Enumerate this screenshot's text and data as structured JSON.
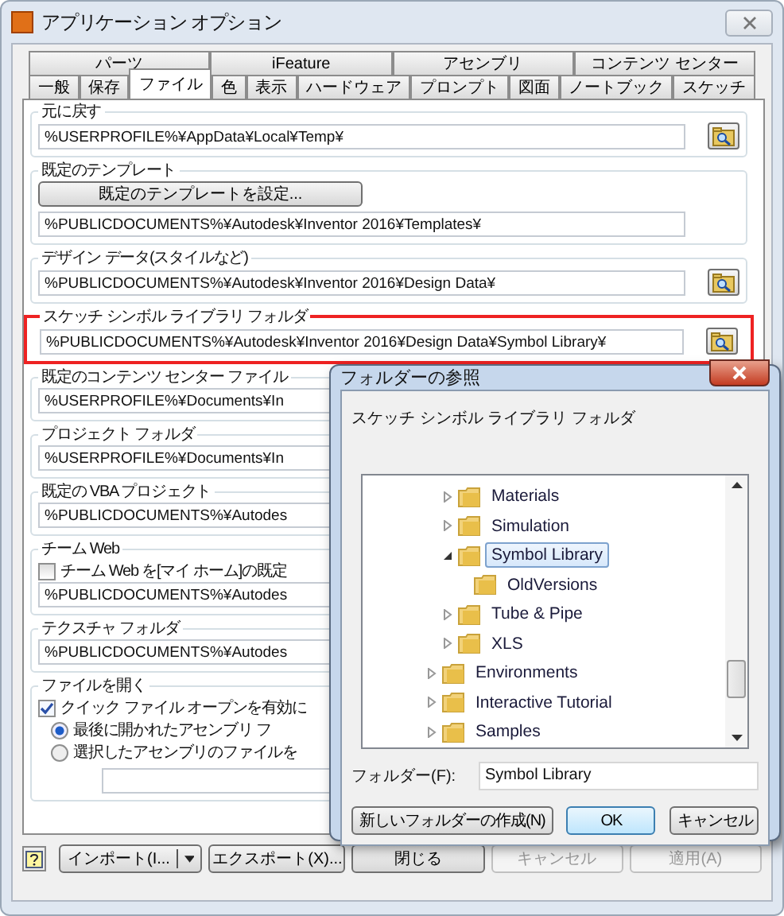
{
  "window": {
    "title": "アプリケーション オプション"
  },
  "tabs_top": [
    {
      "label": "パーツ",
      "selected": false
    },
    {
      "label": "iFeature",
      "selected": false
    },
    {
      "label": "アセンブリ",
      "selected": false
    },
    {
      "label": "コンテンツ センター",
      "selected": false
    }
  ],
  "tabs_bottom": [
    {
      "label": "一般",
      "selected": false
    },
    {
      "label": "保存",
      "selected": false
    },
    {
      "label": "ファイル",
      "selected": true
    },
    {
      "label": "色",
      "selected": false
    },
    {
      "label": "表示",
      "selected": false
    },
    {
      "label": "ハードウェア",
      "selected": false
    },
    {
      "label": "プロンプト",
      "selected": false
    },
    {
      "label": "図面",
      "selected": false
    },
    {
      "label": "ノートブック",
      "selected": false
    },
    {
      "label": "スケッチ",
      "selected": false
    }
  ],
  "sections": [
    {
      "kind": "path",
      "label": "元に戻す",
      "value": "%USERPROFILE%¥AppData¥Local¥Temp¥",
      "browse": true,
      "highlighted": false
    },
    {
      "kind": "button_path",
      "label": "既定のテンプレート",
      "button": "既定のテンプレートを設定...",
      "value": "%PUBLICDOCUMENTS%¥Autodesk¥Inventor 2016¥Templates¥",
      "highlighted": false
    },
    {
      "kind": "path",
      "label": "デザイン データ(スタイルなど)",
      "value": "%PUBLICDOCUMENTS%¥Autodesk¥Inventor 2016¥Design Data¥",
      "browse": true,
      "highlighted": false
    },
    {
      "kind": "path",
      "label": "スケッチ シンボル ライブラリ フォルダ",
      "value": "%PUBLICDOCUMENTS%¥Autodesk¥Inventor 2016¥Design Data¥Symbol Library¥",
      "browse": true,
      "highlighted": true
    },
    {
      "kind": "path",
      "label": "既定のコンテンツ センター ファイル",
      "value": "%USERPROFILE%¥Documents¥In",
      "highlighted": false
    },
    {
      "kind": "path",
      "label": "プロジェクト フォルダ",
      "value": "%USERPROFILE%¥Documents¥In",
      "highlighted": false
    },
    {
      "kind": "path",
      "label": "既定の VBA プロジェクト",
      "value": "%PUBLICDOCUMENTS%¥Autodes",
      "highlighted": false
    },
    {
      "kind": "checkbox_path",
      "label": "チーム Web",
      "checkbox": {
        "label": "チーム Web を[マイ ホーム]の既定",
        "checked": false
      },
      "value": "%PUBLICDOCUMENTS%¥Autodes",
      "highlighted": false
    },
    {
      "kind": "path",
      "label": "テクスチャ フォルダ",
      "value": "%PUBLICDOCUMENTS%¥Autodes",
      "highlighted": false
    },
    {
      "kind": "file_open",
      "label": "ファイルを開く",
      "checkbox": {
        "label": "クイック ファイル オープンを有効に",
        "checked": true
      },
      "radios": [
        {
          "label": "最後に開かれたアセンブリ フ",
          "selected": true
        },
        {
          "label": "選択したアセンブリのファイルを",
          "selected": false
        }
      ],
      "highlighted": false
    }
  ],
  "footer_buttons": [
    {
      "kind": "split",
      "label": "インポート(I...",
      "disabled": false
    },
    {
      "kind": "plain",
      "label": "エクスポート(X)...",
      "disabled": false
    },
    {
      "kind": "plain",
      "label": "閉じる",
      "disabled": false
    },
    {
      "kind": "plain",
      "label": "キャンセル",
      "disabled": true
    },
    {
      "kind": "plain",
      "label": "適用(A)",
      "disabled": true
    }
  ],
  "dialog": {
    "title": "フォルダーの参照",
    "description": "スケッチ シンボル ライブラリ フォルダ",
    "tree": [
      {
        "children": [
          {
            "label": "Materials",
            "expanded": false,
            "selected": false
          },
          {
            "label": "Simulation",
            "expanded": false,
            "selected": false
          },
          {
            "label": "Symbol Library",
            "expanded": true,
            "selected": true,
            "children": [
              {
                "label": "OldVersions",
                "selected": false
              }
            ]
          },
          {
            "label": "Tube & Pipe",
            "expanded": false,
            "selected": false
          },
          {
            "label": "XLS",
            "expanded": false,
            "selected": false
          }
        ]
      },
      {
        "label": "Environments",
        "expanded": false,
        "selected": false
      },
      {
        "label": "Interactive Tutorial",
        "expanded": false,
        "selected": false
      },
      {
        "label": "Samples",
        "expanded": false,
        "selected": false
      }
    ],
    "folder_label": "フォルダー(F):",
    "folder_value": "Symbol Library",
    "buttons": [
      {
        "label": "新しいフォルダーの作成(N)",
        "default": false
      },
      {
        "label": "OK",
        "default": true
      },
      {
        "label": "キャンセル",
        "default": false
      }
    ]
  }
}
